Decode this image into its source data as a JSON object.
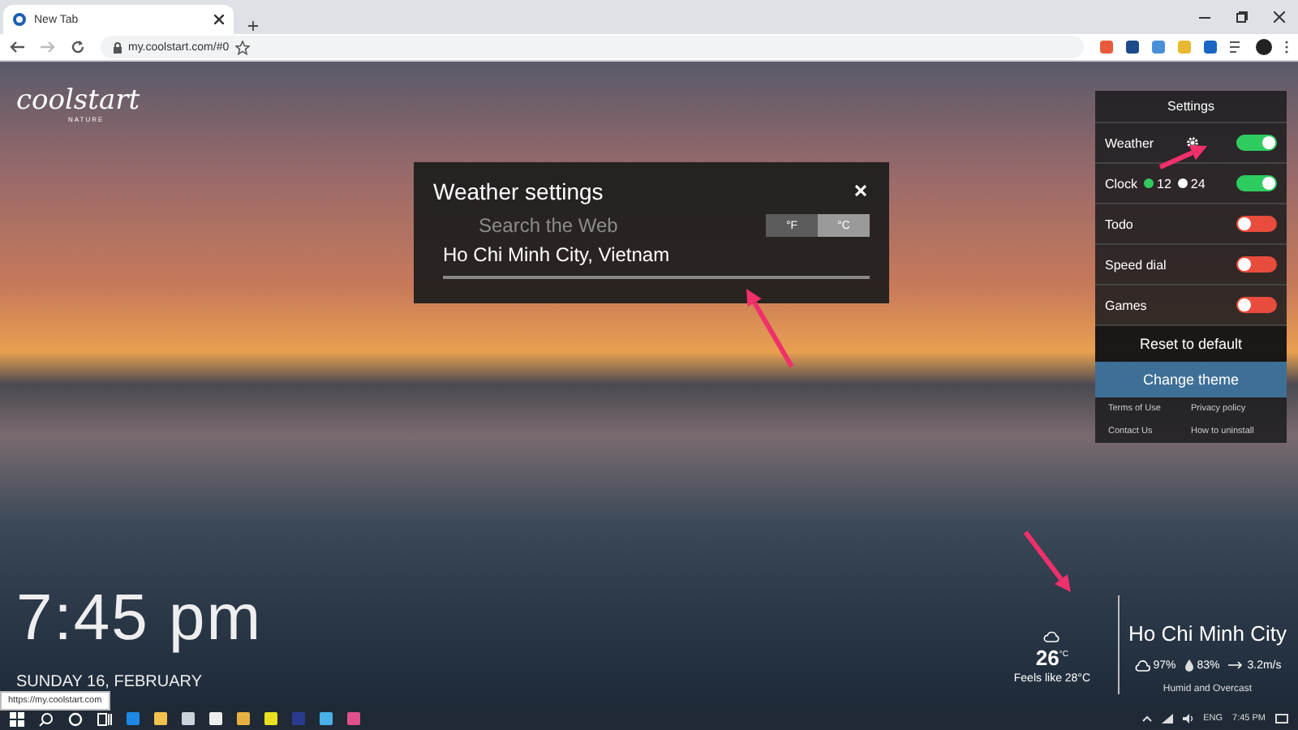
{
  "browser": {
    "tab": {
      "title": "New Tab"
    },
    "address": "my.coolstart.com/#0"
  },
  "logo": {
    "name": "coolstart",
    "tagline": "NATURE"
  },
  "weather_dialog": {
    "title": "Weather settings",
    "units": [
      {
        "label": "°F",
        "selected": false
      },
      {
        "label": "°C",
        "selected": true
      }
    ],
    "search_placeholder": "Search the Web",
    "location": "Ho Chi Minh City, Vietnam"
  },
  "settings": {
    "title": "Settings",
    "items": [
      {
        "kind": "weather",
        "label": "Weather",
        "on": true
      },
      {
        "kind": "clock",
        "label": "Clock",
        "on": true,
        "formats": [
          {
            "label": "12",
            "selected": true
          },
          {
            "label": "24",
            "selected": false
          }
        ]
      },
      {
        "kind": "plain",
        "label": "Todo",
        "on": false
      },
      {
        "kind": "plain",
        "label": "Speed dial",
        "on": false
      },
      {
        "kind": "plain",
        "label": "Games",
        "on": false
      }
    ],
    "reset": "Reset to default",
    "change_theme": "Change theme",
    "links": [
      "Terms of Use",
      "Privacy policy",
      "Contact Us",
      "How to uninstall"
    ]
  },
  "clock": {
    "time": "7:45 pm",
    "date": "SUNDAY 16, FEBRUARY"
  },
  "weather": {
    "temperature": "26$^{°C}$",
    "feels_like": "Feels like 28°C",
    "city": "Ho Chi Minh City",
    "cloud": "97%",
    "humidity": "83%",
    "wind": "3.2m/s",
    "summary": "Humid and Overcast"
  },
  "status_link": "https://my.coolstart.com",
  "taskbar": {
    "language": "ENG",
    "time": "7:45 PM"
  }
}
